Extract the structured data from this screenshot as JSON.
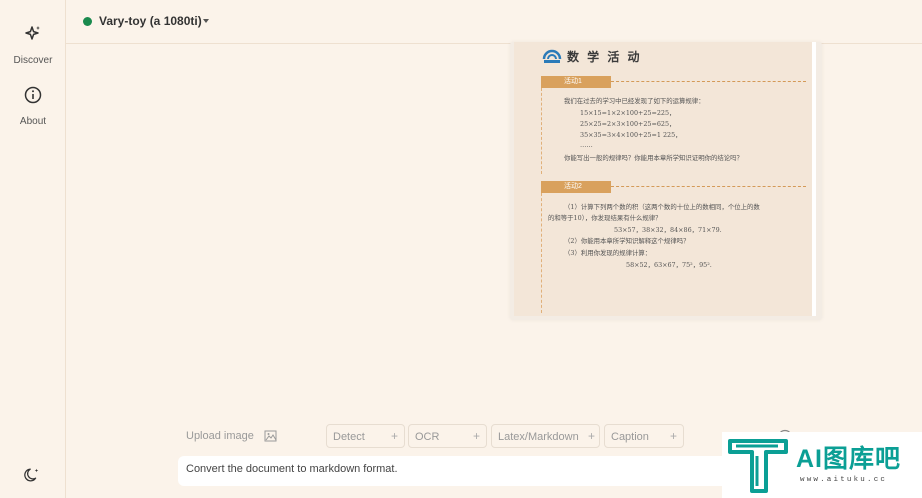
{
  "sidebar": {
    "items": [
      {
        "label": "Discover",
        "icon": "sparkle-icon"
      },
      {
        "label": "About",
        "icon": "info-circle-icon"
      }
    ],
    "theme_icon": "moon-icon"
  },
  "header": {
    "model_name": "Vary-toy (a 1080ti)",
    "status_color": "#1a8a4e"
  },
  "document": {
    "title": "数 学 活 动",
    "activity1_tag": "活动1",
    "activity1_lines": [
      "我们在过去的学习中已经发现了如下的运算规律：",
      "15×15=1×2×100+25=225，",
      "25×25=2×3×100+25=625，",
      "35×35=3×4×100+25=1 225，",
      "……",
      "你能写出一般的规律吗？你能用本章所学知识证明你的结论吗？"
    ],
    "activity2_tag": "活动2",
    "activity2_lines": [
      "（1）计算下列两个数的积（这两个数的十位上的数相同，个位上的数",
      "的和等于10），你发现结果有什么规律？",
      "53×57，38×32，84×86，71×79.",
      "（2）你能用本章所学知识解释这个规律吗？",
      "（3）利用你发现的规律计算：",
      "58×52，63×67，75²，95²."
    ]
  },
  "toolbar": {
    "upload_label": "Upload image",
    "chips": [
      {
        "label": "Detect",
        "symbol": "+"
      },
      {
        "label": "OCR",
        "symbol": "+"
      },
      {
        "label": "Latex/Markdown",
        "symbol": "+"
      },
      {
        "label": "Caption",
        "symbol": "+"
      }
    ]
  },
  "prompt": {
    "text": "Convert the document to markdown format."
  },
  "watermark": {
    "main": "AI图库吧",
    "sub": "www.aituku.cc"
  }
}
